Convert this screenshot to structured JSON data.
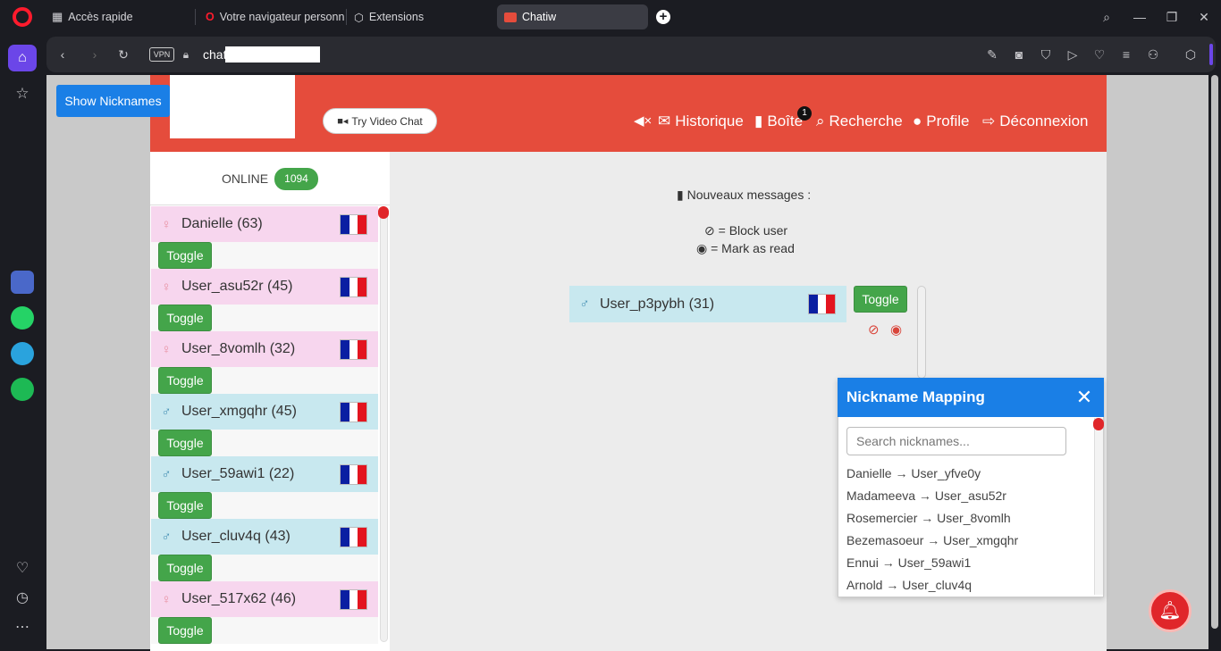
{
  "browser": {
    "tabs": [
      {
        "label": "Accès rapide",
        "icon": "grid-icon"
      },
      {
        "label": "Votre navigateur personne",
        "icon": "opera-icon"
      },
      {
        "label": "Extensions",
        "icon": "cube-icon"
      },
      {
        "label": "Chatiw",
        "icon": "chatiw-icon",
        "active": true
      }
    ],
    "vpn_label": "VPN",
    "url": "chat",
    "accent": "#e54c3c"
  },
  "header": {
    "show_nicknames": "Show Nicknames",
    "video_chat": "Try Video Chat",
    "nav": {
      "historique": "Historique",
      "boite": "Boîte",
      "boite_badge": "1",
      "recherche": "Recherche",
      "profile": "Profile",
      "deconnexion": "Déconnexion"
    }
  },
  "online": {
    "label": "ONLINE",
    "count": "1094"
  },
  "users": [
    {
      "name": "Danielle (63)",
      "gender": "female"
    },
    {
      "name": "User_asu52r (45)",
      "gender": "female"
    },
    {
      "name": "User_8vomlh (32)",
      "gender": "female"
    },
    {
      "name": "User_xmgqhr (45)",
      "gender": "male"
    },
    {
      "name": "User_59awi1 (22)",
      "gender": "male"
    },
    {
      "name": "User_cluv4q (43)",
      "gender": "male"
    },
    {
      "name": "User_517x62 (46)",
      "gender": "female"
    }
  ],
  "toggle_label": "Toggle",
  "messages": {
    "title": "Nouveaux messages :",
    "block_legend": "= Block user",
    "read_legend": "= Mark as read",
    "conversation_user": "User_p3pybh (31)"
  },
  "nickname_mapping": {
    "title": "Nickname Mapping",
    "search_placeholder": "Search nicknames...",
    "items": [
      "Danielle → User_yfve0y",
      "Madameeva → User_asu52r",
      "Rosemercier → User_8vomlh",
      "Bezemasoeur → User_xmgqhr",
      "Ennui → User_59awi1",
      "Arnold → User_cluv4q"
    ]
  }
}
